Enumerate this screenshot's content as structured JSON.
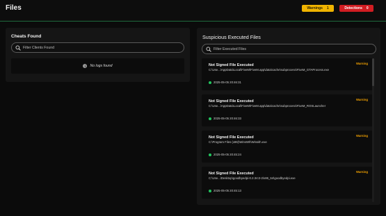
{
  "header": {
    "title": "Files",
    "warnings_label": "Warnings",
    "warnings_count": "1",
    "detections_label": "Detections",
    "detections_count": "0"
  },
  "cheats_panel": {
    "title": "Cheats Found",
    "search_placeholder": "Filter Clients Found",
    "empty_text": "No logs found"
  },
  "executed_panel": {
    "title": "Suspicious Executed Files",
    "search_placeholder": "Filter Executed Files",
    "items": [
      {
        "title": "Not Signed File Executed",
        "path": "C:\\Use...\\AppData\\Local\\FiveM\\FiveM.app\\data\\cache\\subprocess\\FiveM_GTAProcess.exe",
        "status": "Warning",
        "time": "2025-05-05 20:46:31"
      },
      {
        "title": "Not Signed File Executed",
        "path": "C:\\Use...\\AppData\\Local\\FiveM\\FiveM.app\\data\\cache\\subprocess\\FiveM_ROSLauncher",
        "status": "Warning",
        "time": "2025-05-05 20:46:33"
      },
      {
        "title": "Not Signed File Executed",
        "path": "C:\\Program Files (x86)\\WinsWh\\Winsith.exe",
        "status": "Warning",
        "time": "2025-05-05 20:45:24"
      },
      {
        "title": "Not Signed File Executed",
        "path": "C:\\Use...\\Desktop\\goodbyedpi-0.2.3rc3-2\\x86_64\\goodbyedpi.exe",
        "status": "Warning",
        "time": "2025-05-05 20:45:13"
      }
    ]
  },
  "colors": {
    "warning": "#f0b400",
    "detection": "#d11d22",
    "ok_dot": "#22c55e",
    "divider": "#1f6b3d"
  }
}
